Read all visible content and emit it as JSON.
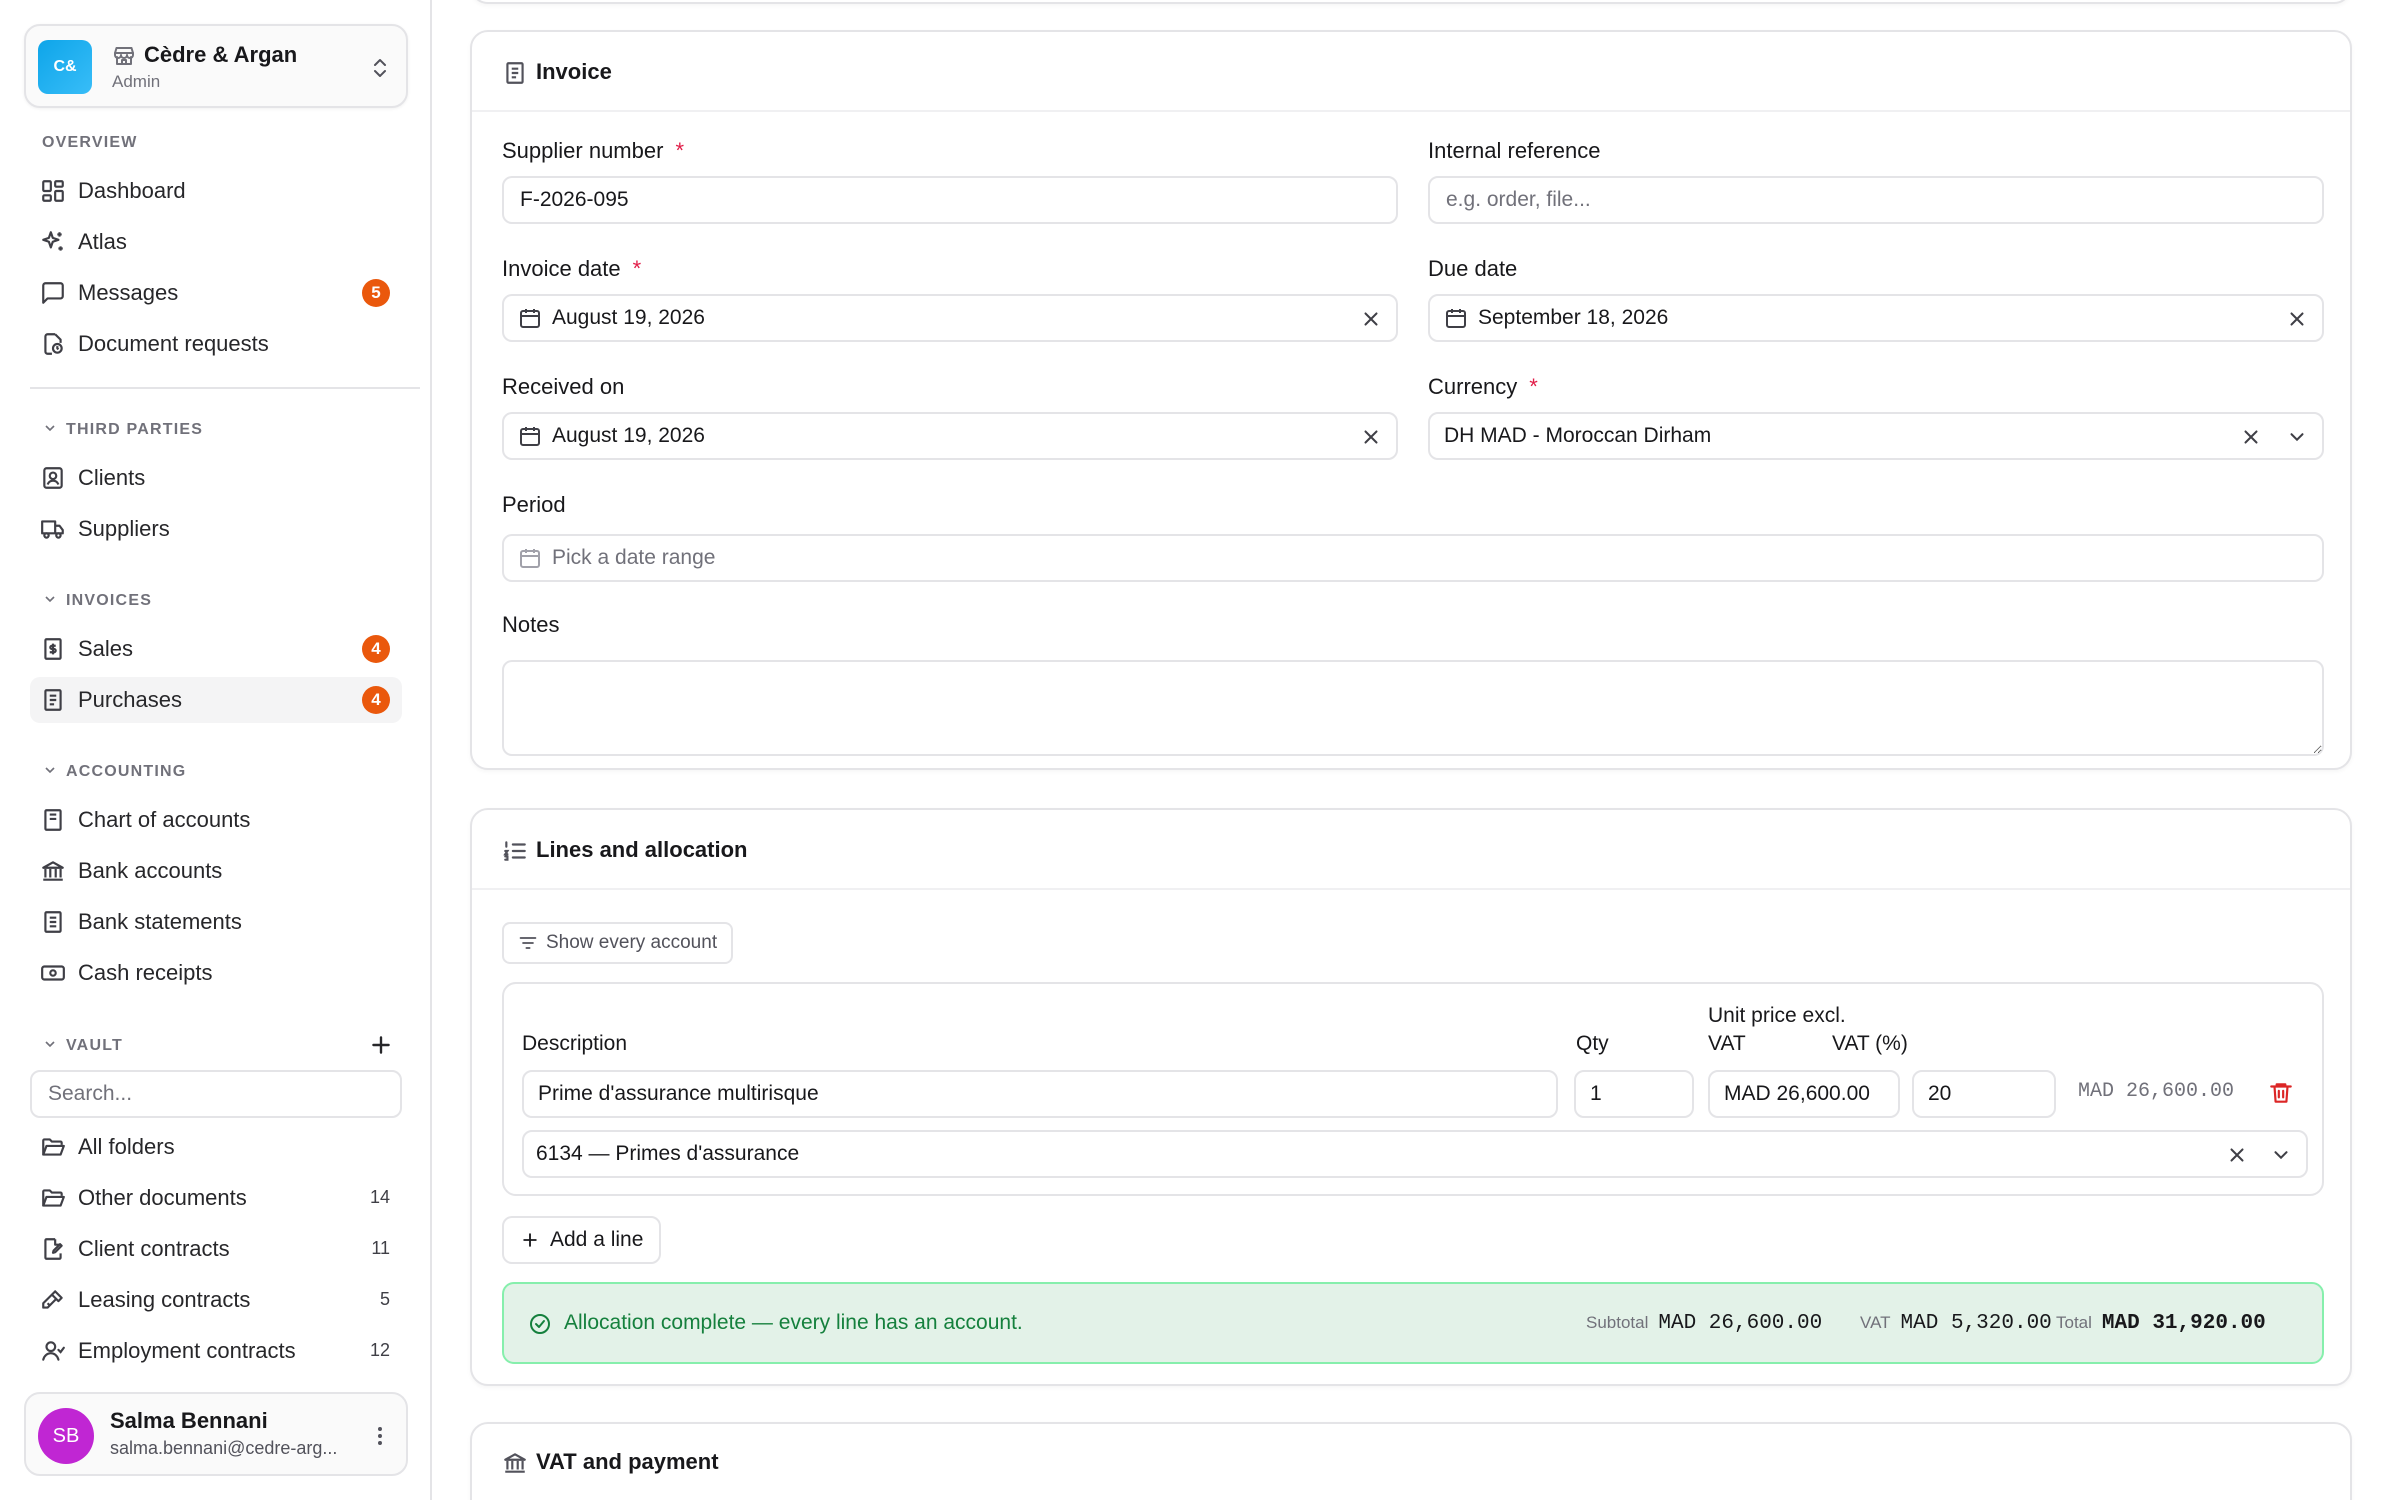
{
  "org": {
    "logo": "C&",
    "name": "Cèdre & Argan",
    "role": "Admin"
  },
  "nav": {
    "overview_label": "OVERVIEW",
    "overview": [
      {
        "label": "Dashboard",
        "icon": "dashboard-icon"
      },
      {
        "label": "Atlas",
        "icon": "sparkles-icon"
      },
      {
        "label": "Messages",
        "icon": "message-icon",
        "badge": "5"
      },
      {
        "label": "Document requests",
        "icon": "document-request-icon"
      }
    ],
    "third_parties_label": "THIRD PARTIES",
    "third_parties": [
      {
        "label": "Clients",
        "icon": "contact-icon"
      },
      {
        "label": "Suppliers",
        "icon": "truck-icon"
      }
    ],
    "invoices_label": "INVOICES",
    "invoices": [
      {
        "label": "Sales",
        "icon": "receipt-icon",
        "badge": "4"
      },
      {
        "label": "Purchases",
        "icon": "file-text-icon",
        "badge": "4",
        "active": true
      }
    ],
    "accounting_label": "ACCOUNTING",
    "accounting": [
      {
        "label": "Chart of accounts",
        "icon": "book-icon"
      },
      {
        "label": "Bank accounts",
        "icon": "bank-icon"
      },
      {
        "label": "Bank statements",
        "icon": "statement-icon"
      },
      {
        "label": "Cash receipts",
        "icon": "cash-icon"
      }
    ],
    "vault_label": "VAULT",
    "vault_search_placeholder": "Search...",
    "vault": [
      {
        "label": "All folders",
        "icon": "folder-open-icon"
      },
      {
        "label": "Other documents",
        "icon": "folder-open-icon",
        "count": "14"
      },
      {
        "label": "Client contracts",
        "icon": "file-signature-icon",
        "count": "11"
      },
      {
        "label": "Leasing contracts",
        "icon": "key-icon",
        "count": "5"
      },
      {
        "label": "Employment contracts",
        "icon": "user-icon",
        "count": "12"
      }
    ]
  },
  "user": {
    "initials": "SB",
    "name": "Salma Bennani",
    "email": "salma.bennani@cedre-arg..."
  },
  "invoice": {
    "title": "Invoice",
    "supplier_number_label": "Supplier number",
    "supplier_number_value": "F-2026-095",
    "internal_reference_label": "Internal reference",
    "internal_reference_placeholder": "e.g. order, file...",
    "invoice_date_label": "Invoice date",
    "invoice_date_value": "August 19, 2026",
    "due_date_label": "Due date",
    "due_date_value": "September 18, 2026",
    "received_on_label": "Received on",
    "received_on_value": "August 19, 2026",
    "currency_label": "Currency",
    "currency_value": "DH MAD - Moroccan Dirham",
    "period_label": "Period",
    "period_placeholder": "Pick a date range",
    "notes_label": "Notes",
    "required_mark": "*"
  },
  "lines": {
    "title": "Lines and allocation",
    "show_every_account": "Show every account",
    "col_description": "Description",
    "col_qty": "Qty",
    "col_unit_price_1": "Unit price excl.",
    "col_unit_price_2": "VAT",
    "col_vat": "VAT (%)",
    "rows": [
      {
        "description": "Prime d'assurance multirisque",
        "qty": "1",
        "unit_price": "MAD 26,600.00",
        "vat": "20",
        "total": "MAD 26,600.00",
        "account": "6134 — Primes d'assurance"
      }
    ],
    "add_line": "Add a line",
    "allocation_message": "Allocation complete — every line has an account.",
    "subtotal_label": "Subtotal",
    "subtotal_value": "MAD 26,600.00",
    "vat_label": "VAT",
    "vat_value": "MAD 5,320.00",
    "total_label": "Total",
    "total_value": "MAD 31,920.00"
  },
  "vat_payment": {
    "title": "VAT and payment"
  },
  "colors": {
    "accent": "#ea580c",
    "success_bg": "#e3f2e8",
    "success_text": "#15803d",
    "danger": "#dc2626"
  }
}
